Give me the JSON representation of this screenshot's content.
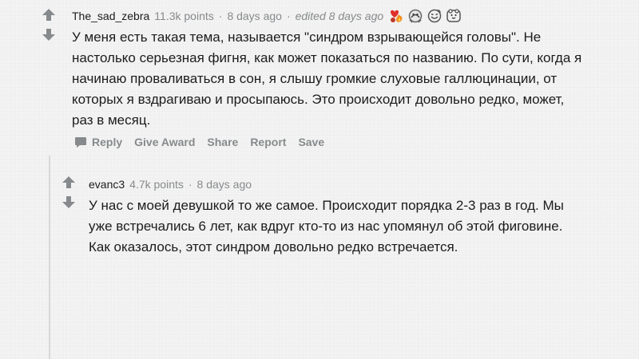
{
  "comments": [
    {
      "author": "The_sad_zebra",
      "points": "11.3k points",
      "time": "8 days ago",
      "edited": "edited 8 days ago",
      "awards": [
        "fire-award-icon",
        "silver-award-icon",
        "wholesome-award-icon",
        "hugz-award-icon"
      ],
      "body": "У меня есть такая тема, называется \"синдром взрывающейся головы\". Не настолько серьезная фигня, как может показаться по названию. По сути, когда я начинаю проваливаться в сон, я слышу громкие слуховые галлюцинации, от которых я вздрагиваю и просыпаюсь. Это происходит довольно редко, может, раз в месяц.",
      "actions": {
        "reply": "Reply",
        "give_award": "Give Award",
        "share": "Share",
        "report": "Report",
        "save": "Save"
      }
    },
    {
      "author": "evanc3",
      "points": "4.7k points",
      "time": "8 days ago",
      "body": "У нас с моей девушкой то же самое. Происходит порядка 2-3 раз в год. Мы уже встречались 6 лет, как вдруг кто-то из нас упомянул об этой фиговине. Как оказалось, этот синдром довольно редко встречается."
    }
  ],
  "colors": {
    "text": "#1c1c1c",
    "meta": "#878a8c",
    "arrow": "#878a8c",
    "thread_line": "#d8d8d8"
  },
  "separator": "·"
}
